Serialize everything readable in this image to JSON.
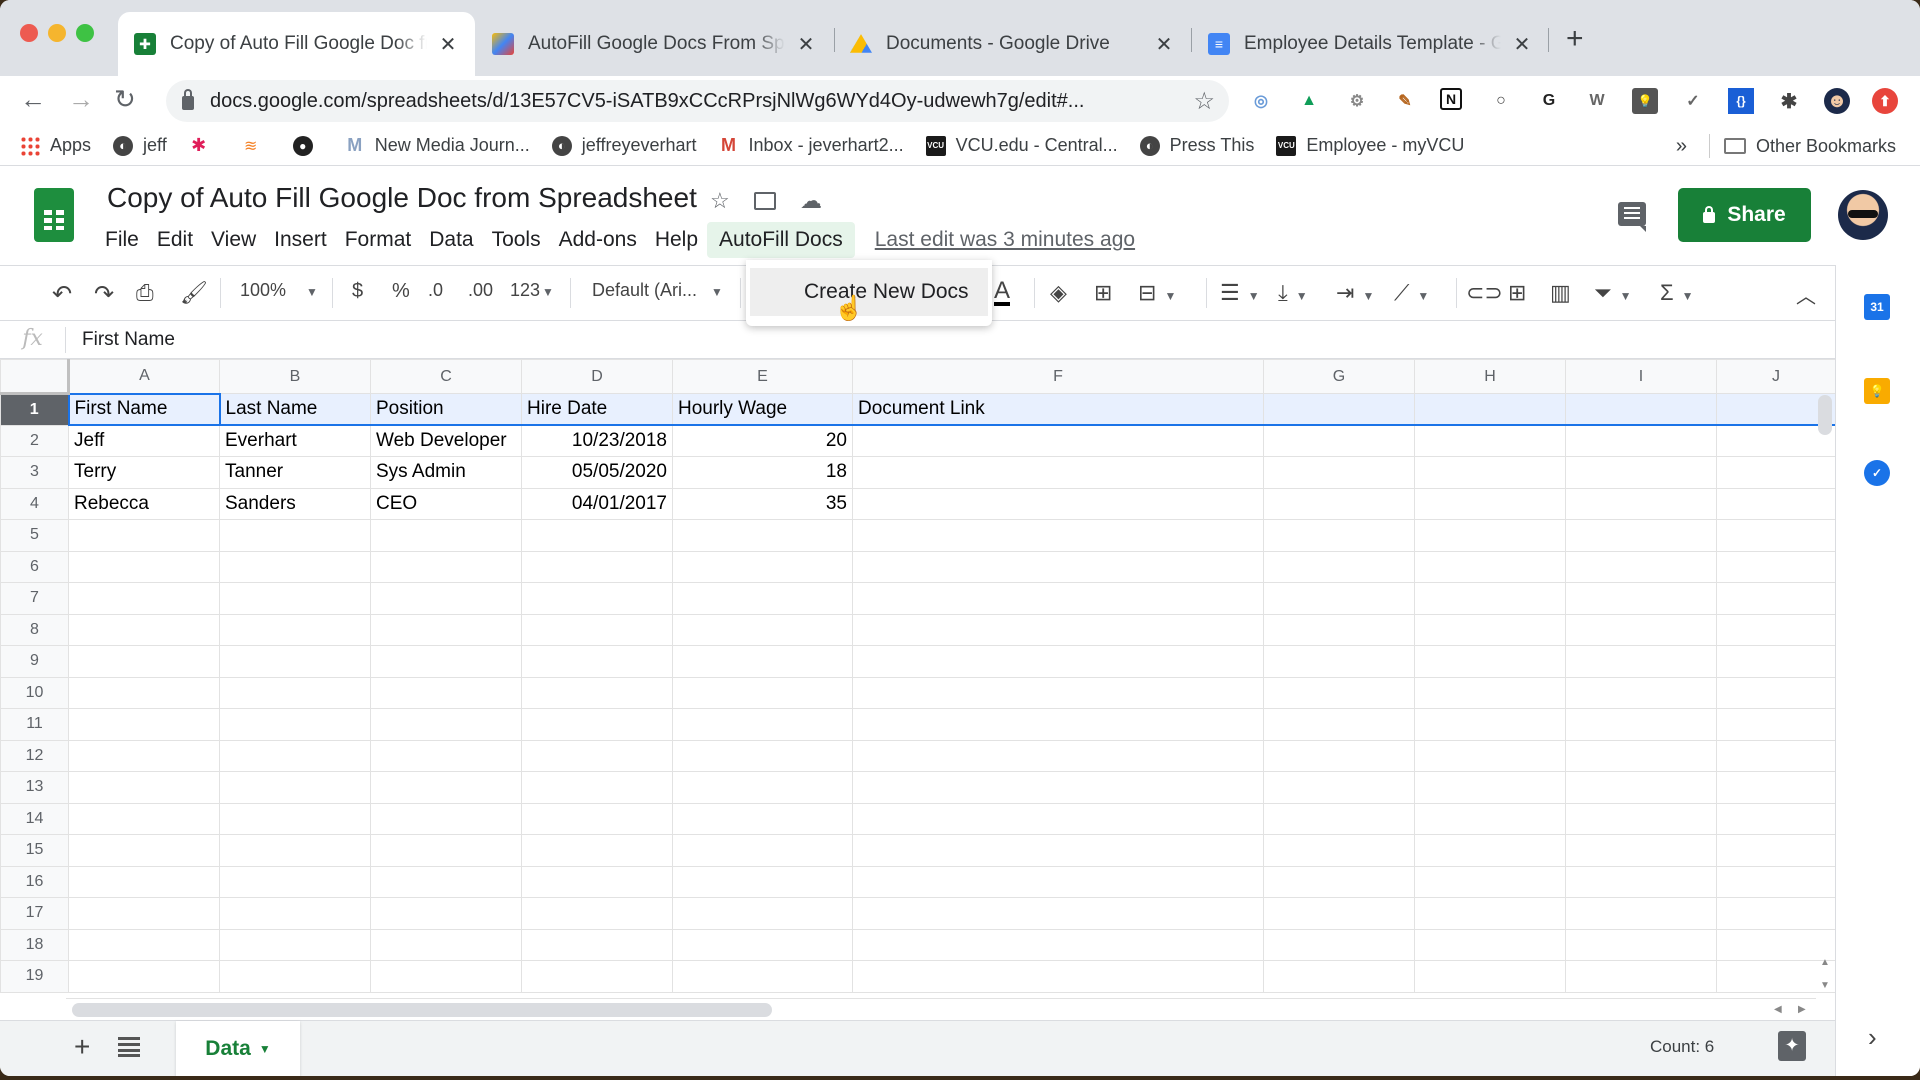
{
  "browser": {
    "tabs": [
      {
        "title": "Copy of Auto Fill Google Doc from Spreadsheet",
        "icon": "sheets-icon",
        "active": true
      },
      {
        "title": "AutoFill Google Docs From Spreadsheet",
        "icon": "apps-script-icon",
        "active": false
      },
      {
        "title": "Documents - Google Drive",
        "icon": "drive-icon",
        "active": false
      },
      {
        "title": "Employee Details Template - Google Docs",
        "icon": "docs-icon",
        "active": false
      }
    ],
    "close_glyph": "✕",
    "new_tab_glyph": "+",
    "url": "docs.google.com/spreadsheets/d/13E57CV5-iSATB9xCCcRPrsjNlWg6WYd4Oy-udwewh7g/edit#...",
    "nav": {
      "back": "←",
      "forward": "→",
      "reload": "↻",
      "star": "☆"
    },
    "extensions": [
      "refresh-ext-icon",
      "drive-ext-icon",
      "gear-ext-icon",
      "eyedropper-ext-icon",
      "notion-ext-icon",
      "circle-ext-icon",
      "grammarly-ext-icon",
      "wordpress-ext-icon",
      "lightbulb-ext-icon",
      "shield-ext-icon",
      "json-ext-icon",
      "puzzle-ext-icon",
      "profile-avatar-icon",
      "upload-ext-icon"
    ],
    "extension_glyphs": [
      "◎",
      "▲",
      "⚙",
      "✎",
      "N",
      "○",
      "G",
      "W",
      "💡",
      "✓",
      "{}",
      "✱",
      "☻",
      "⬆"
    ],
    "bookmarks": [
      {
        "label": "Apps",
        "icon": "apps-grid-icon"
      },
      {
        "label": "jeff",
        "icon": "globe-icon"
      },
      {
        "label": "",
        "icon": "slack-icon"
      },
      {
        "label": "",
        "icon": "stackoverflow-icon"
      },
      {
        "label": "",
        "icon": "github-icon"
      },
      {
        "label": "New Media Journ...",
        "icon": "medium-icon"
      },
      {
        "label": "jeffreyeverhart",
        "icon": "globe-icon"
      },
      {
        "label": "Inbox - jeverhart2...",
        "icon": "gmail-icon"
      },
      {
        "label": "VCU.edu - Central...",
        "icon": "vcu-icon"
      },
      {
        "label": "Press This",
        "icon": "globe-icon"
      },
      {
        "label": "Employee - myVCU",
        "icon": "vcu-icon"
      }
    ],
    "bookmarks_overflow": "»",
    "other_bookmarks": "Other Bookmarks"
  },
  "sheets": {
    "doc_title": "Copy of Auto Fill Google Doc from Spreadsheet",
    "menu": [
      "File",
      "Edit",
      "View",
      "Insert",
      "Format",
      "Data",
      "Tools",
      "Add-ons",
      "Help",
      "AutoFill Docs"
    ],
    "open_menu": "AutoFill Docs",
    "last_edit": "Last edit was 3 minutes ago",
    "share_label": "Share",
    "dropdown": {
      "items": [
        "Create New Docs"
      ]
    },
    "toolbar": {
      "zoom": "100%",
      "currency": "$",
      "percent": "%",
      "decrease_decimal": ".0",
      "increase_decimal": ".00",
      "more_formats": "123",
      "font": "Default (Ari...",
      "sum": "Σ"
    },
    "formula_bar": {
      "fx": "fx",
      "value": "First Name"
    },
    "grid": {
      "columns": [
        "A",
        "B",
        "C",
        "D",
        "E",
        "F",
        "G",
        "H",
        "I",
        "J"
      ],
      "row_numbers": [
        "1",
        "2",
        "3",
        "4",
        "5",
        "6",
        "7",
        "8",
        "9",
        "10",
        "11",
        "12",
        "13",
        "14",
        "15",
        "16",
        "17",
        "18",
        "19"
      ],
      "rows": [
        [
          "First Name",
          "Last Name",
          "Position",
          "Hire Date",
          "Hourly Wage",
          "Document Link",
          "",
          "",
          "",
          ""
        ],
        [
          "Jeff",
          "Everhart",
          "Web Developer",
          "10/23/2018",
          "20",
          "",
          "",
          "",
          "",
          ""
        ],
        [
          "Terry",
          "Tanner",
          "Sys Admin",
          "05/05/2020",
          "18",
          "",
          "",
          "",
          "",
          ""
        ],
        [
          "Rebecca",
          "Sanders",
          "CEO",
          "04/01/2017",
          "35",
          "",
          "",
          "",
          "",
          ""
        ]
      ],
      "numeric_columns": [
        3,
        4
      ]
    },
    "sheet_tabs": [
      {
        "label": "Data",
        "active": true
      }
    ],
    "add_sheet": "+",
    "status": "Count: 6",
    "side_panel": {
      "calendar_label": "31"
    }
  },
  "colors": {
    "sheets_green": "#188038",
    "selection_blue": "#1a73e8",
    "header_fill": "#e8f0fe"
  }
}
